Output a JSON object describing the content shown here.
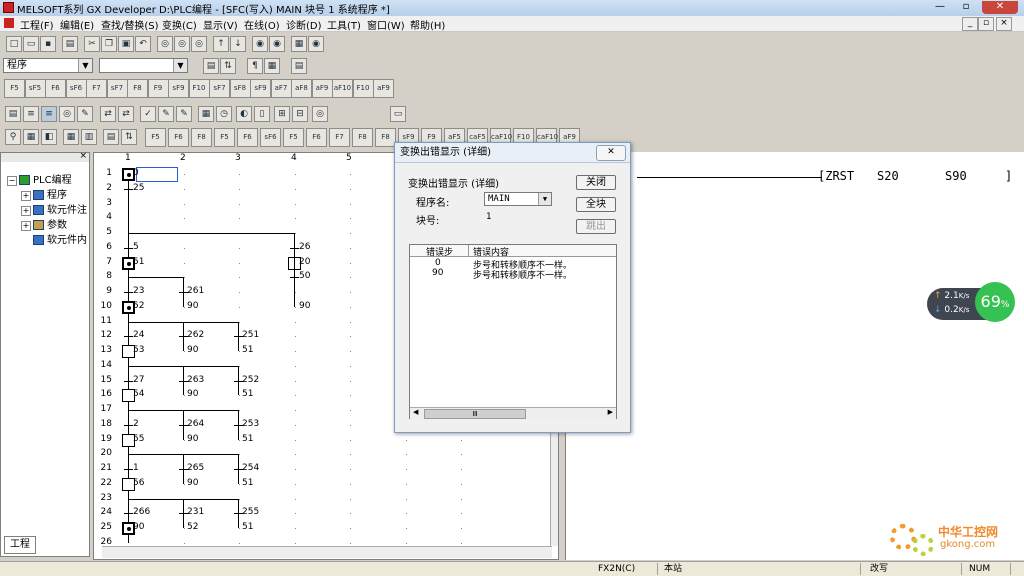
{
  "window": {
    "title": "MELSOFT系列 GX Developer D:\\PLC编程 - [SFC(写入)    MAIN    块号   1  系统程序   *]",
    "min": "—",
    "max": "▫",
    "close": "✕"
  },
  "menu": [
    "工程(F)",
    "编辑(E)",
    "查找/替换(S)",
    "变换(C)",
    "显示(V)",
    "在线(O)",
    "诊断(D)",
    "工具(T)",
    "窗口(W)",
    "帮助(H)"
  ],
  "mdi_controls": [
    "_",
    "▫",
    "×"
  ],
  "toolbar": {
    "program_combo": "程序",
    "second_combo": "",
    "sfc_keys_row1": [
      "F5",
      "sF5",
      "F6",
      "sF6",
      "F7",
      "sF7",
      "F8",
      "F9",
      "sF9",
      "F10",
      "sF7",
      "sF8",
      "sF9",
      "aF7",
      "aF8",
      "aF9",
      "aF10",
      "F10",
      "aF9"
    ],
    "sfc_keys_row4": [
      "F5",
      "F6",
      "F8",
      "F5",
      "F6",
      "sF6",
      "F5",
      "F6",
      "F7",
      "F8",
      "F8",
      "sF9",
      "F9",
      "aF5",
      "caF5",
      "caF10",
      "F10",
      "caF10",
      "aF9"
    ]
  },
  "project_tree": {
    "root": "PLC编程",
    "items": [
      {
        "label": "程序"
      },
      {
        "label": "软元件注"
      },
      {
        "label": "参数"
      },
      {
        "label": "软元件内"
      }
    ],
    "tab": "工程"
  },
  "sfc": {
    "columns": [
      "1",
      "2",
      "3",
      "4",
      "5"
    ],
    "rows": [
      "1",
      "2",
      "3",
      "4",
      "5",
      "6",
      "7",
      "8",
      "9",
      "10",
      "11",
      "12",
      "13",
      "14",
      "15",
      "16",
      "17",
      "18",
      "19",
      "20",
      "21",
      "22",
      "23",
      "24",
      "25",
      "26"
    ],
    "col1_labels": [
      {
        "row": 1,
        "text": "0"
      },
      {
        "row": 2,
        "text": "25"
      },
      {
        "row": 6,
        "text": "5"
      },
      {
        "row": 7,
        "text": "51"
      },
      {
        "row": 9,
        "text": "23"
      },
      {
        "row": 10,
        "text": "52"
      },
      {
        "row": 12,
        "text": "24"
      },
      {
        "row": 13,
        "text": "53"
      },
      {
        "row": 15,
        "text": "27"
      },
      {
        "row": 16,
        "text": "54"
      },
      {
        "row": 18,
        "text": "2"
      },
      {
        "row": 19,
        "text": "55"
      },
      {
        "row": 21,
        "text": "1"
      },
      {
        "row": 22,
        "text": "56"
      },
      {
        "row": 24,
        "text": "266"
      },
      {
        "row": 25,
        "text": "90"
      }
    ],
    "col2_labels": [
      {
        "row": 9,
        "text": "261"
      },
      {
        "row": 10,
        "text": "90"
      },
      {
        "row": 12,
        "text": "262"
      },
      {
        "row": 13,
        "text": "90"
      },
      {
        "row": 15,
        "text": "263"
      },
      {
        "row": 16,
        "text": "90"
      },
      {
        "row": 18,
        "text": "264"
      },
      {
        "row": 19,
        "text": "90"
      },
      {
        "row": 21,
        "text": "265"
      },
      {
        "row": 22,
        "text": "90"
      },
      {
        "row": 24,
        "text": "231"
      },
      {
        "row": 25,
        "text": "52"
      }
    ],
    "col3_labels": [
      {
        "row": 12,
        "text": "251"
      },
      {
        "row": 13,
        "text": "51"
      },
      {
        "row": 15,
        "text": "252"
      },
      {
        "row": 16,
        "text": "51"
      },
      {
        "row": 18,
        "text": "253"
      },
      {
        "row": 19,
        "text": "51"
      },
      {
        "row": 21,
        "text": "254"
      },
      {
        "row": 22,
        "text": "51"
      },
      {
        "row": 24,
        "text": "255"
      },
      {
        "row": 25,
        "text": "51"
      }
    ],
    "col4_labels": [
      {
        "row": 6,
        "text": "26"
      },
      {
        "row": 7,
        "text": "20"
      },
      {
        "row": 8,
        "text": "50"
      },
      {
        "row": 10,
        "text": "90"
      }
    ]
  },
  "ladder": {
    "instruction": "[ZRST",
    "op1": "S20",
    "op2": "S90",
    "close": "]"
  },
  "dialog": {
    "title": "变换出错显示 (详细)",
    "close_label": "✕",
    "subtitle": "变换出错显示 (详细)",
    "program_name_label": "程序名:",
    "program_name_value": "MAIN",
    "block_no_label": "块号:",
    "block_no_value": "1",
    "buttons": {
      "close": "关闭",
      "all_blocks": "全块",
      "jump": "跳出"
    },
    "list_headers": [
      "错误步",
      "错误内容"
    ],
    "errors": [
      {
        "step": "0",
        "content": "步号和转移顺序不一样。"
      },
      {
        "step": "90",
        "content": "步号和转移顺序不一样。"
      }
    ],
    "scroll_thumb": "Ⅲ"
  },
  "status": {
    "plc_model": "FX2N(C)",
    "station": "本站",
    "overwrite": "改写",
    "numlock": "NUM"
  },
  "network_widget": {
    "up": "2.1",
    "up_unit": "K/s",
    "down": "0.2",
    "down_unit": "K/s",
    "percent": "69",
    "percent_sign": "%"
  },
  "watermark": {
    "cn": "中华工控网",
    "url": "gkong.com"
  }
}
